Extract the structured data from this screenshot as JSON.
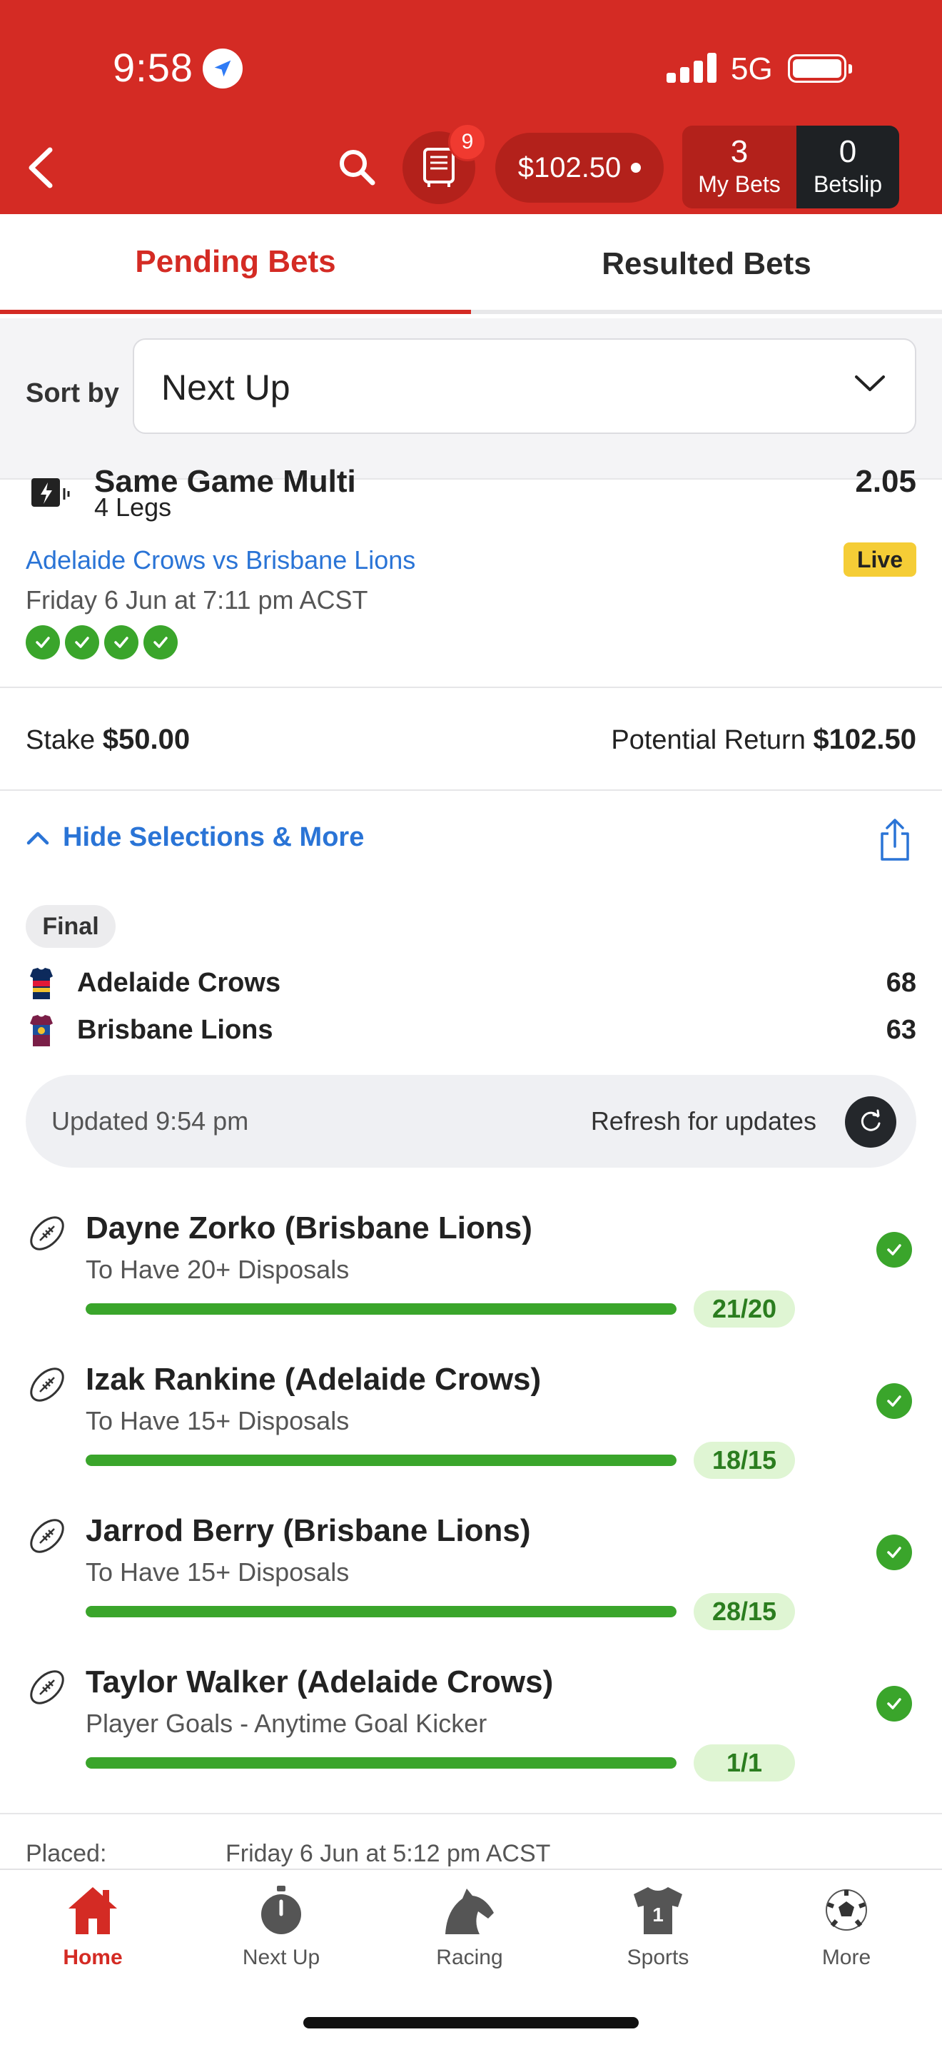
{
  "status_bar": {
    "time": "9:58",
    "network": "5G"
  },
  "header": {
    "safe_badge_count": "9",
    "balance": "$102.50",
    "my_bets_count": "3",
    "my_bets_label": "My Bets",
    "betslip_count": "0",
    "betslip_label": "Betslip",
    "brand_color": "#d42b24"
  },
  "tabs": [
    {
      "label": "Pending Bets",
      "active": true
    },
    {
      "label": "Resulted Bets",
      "active": false
    }
  ],
  "sort": {
    "label": "Sort by",
    "value": "Next Up"
  },
  "bet": {
    "title": "Same Game Multi",
    "odds": "2.05",
    "legs": "4 Legs",
    "match": "Adelaide Crows vs Brisbane Lions",
    "live_label": "Live",
    "match_time": "Friday 6 Jun at 7:11 pm ACST",
    "stake_label": "Stake",
    "stake_value": "$50.00",
    "potential_label": "Potential Return",
    "potential_value": "$102.50",
    "toggle_label": "Hide Selections & More",
    "status_pill": "Final",
    "teams": [
      {
        "name": "Adelaide Crows",
        "score": "68"
      },
      {
        "name": "Brisbane Lions",
        "score": "63"
      }
    ],
    "updated": "Updated 9:54 pm",
    "refresh_label": "Refresh for updates",
    "selections": [
      {
        "player": "Dayne Zorko (Brisbane Lions)",
        "market": "To Have 20+ Disposals",
        "progress": "21/20",
        "fill": 1.0
      },
      {
        "player": "Izak Rankine (Adelaide Crows)",
        "market": "To Have 15+ Disposals",
        "progress": "18/15",
        "fill": 1.0
      },
      {
        "player": "Jarrod Berry (Brisbane Lions)",
        "market": "To Have 15+ Disposals",
        "progress": "28/15",
        "fill": 1.0
      },
      {
        "player": "Taylor Walker (Adelaide Crows)",
        "market": "Player Goals - Anytime Goal Kicker",
        "progress": "1/1",
        "fill": 1.0
      }
    ],
    "placed_label": "Placed:",
    "placed_value": "Friday 6 Jun at 5:12 pm ACST"
  },
  "bottom_nav": [
    {
      "label": "Home",
      "icon": "home-icon",
      "active": true
    },
    {
      "label": "Next Up",
      "icon": "stopwatch-icon",
      "active": false
    },
    {
      "label": "Racing",
      "icon": "horse-icon",
      "active": false
    },
    {
      "label": "Sports",
      "icon": "jersey-icon",
      "active": false
    },
    {
      "label": "More",
      "icon": "soccer-ball-icon",
      "active": false
    }
  ]
}
